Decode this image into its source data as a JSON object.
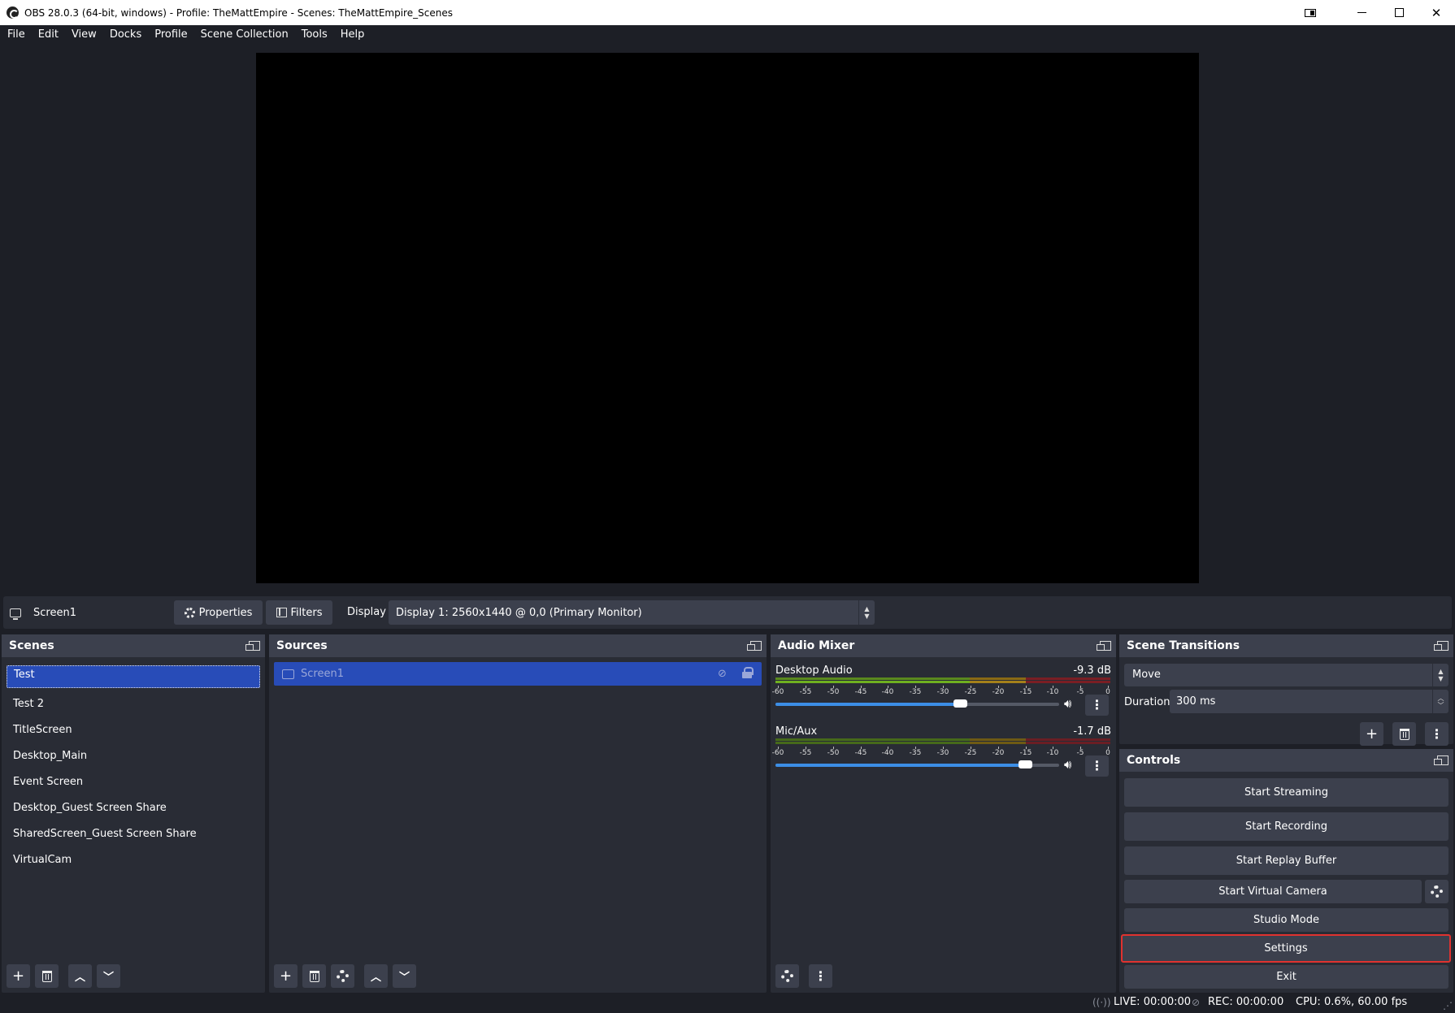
{
  "window": {
    "title": "OBS 28.0.3 (64-bit, windows) - Profile: TheMattEmpire - Scenes: TheMattEmpire_Scenes"
  },
  "menu": [
    "File",
    "Edit",
    "View",
    "Docks",
    "Profile",
    "Scene Collection",
    "Tools",
    "Help"
  ],
  "source_toolbar": {
    "source_name": "Screen1",
    "properties_label": "Properties",
    "filters_label": "Filters",
    "display_label": "Display",
    "display_value": "Display 1: 2560x1440 @ 0,0 (Primary Monitor)"
  },
  "scenes": {
    "title": "Scenes",
    "items": [
      "Test",
      "Test 2",
      "TitleScreen",
      "Desktop_Main",
      "Event Screen",
      "Desktop_Guest Screen Share",
      "SharedScreen_Guest Screen Share",
      "VirtualCam"
    ],
    "selected": "Test"
  },
  "sources": {
    "title": "Sources",
    "items": [
      {
        "name": "Screen1",
        "visible": false,
        "locked": true
      }
    ]
  },
  "audio_mixer": {
    "title": "Audio Mixer",
    "channels": [
      {
        "name": "Desktop Audio",
        "db": "-9.3 dB",
        "volume_fraction": 0.65
      },
      {
        "name": "Mic/Aux",
        "db": "-1.7 dB",
        "volume_fraction": 0.88
      }
    ],
    "ticks": [
      "-60",
      "-55",
      "-50",
      "-45",
      "-40",
      "-35",
      "-30",
      "-25",
      "-20",
      "-15",
      "-10",
      "-5",
      "0"
    ]
  },
  "scene_transitions": {
    "title": "Scene Transitions",
    "transition": "Move",
    "duration_label": "Duration",
    "duration_value": "300 ms"
  },
  "controls": {
    "title": "Controls",
    "start_streaming": "Start Streaming",
    "start_recording": "Start Recording",
    "start_replay_buffer": "Start Replay Buffer",
    "start_virtual_camera": "Start Virtual Camera",
    "studio_mode": "Studio Mode",
    "settings": "Settings",
    "exit": "Exit"
  },
  "status": {
    "live": "LIVE: 00:00:00",
    "rec": "REC: 00:00:00",
    "cpu": "CPU: 0.6%, 60.00 fps"
  },
  "colors": {
    "accent_selected": "#284cb8",
    "highlight_outline": "#e0322f",
    "volume_blue": "#3c8ee6"
  }
}
